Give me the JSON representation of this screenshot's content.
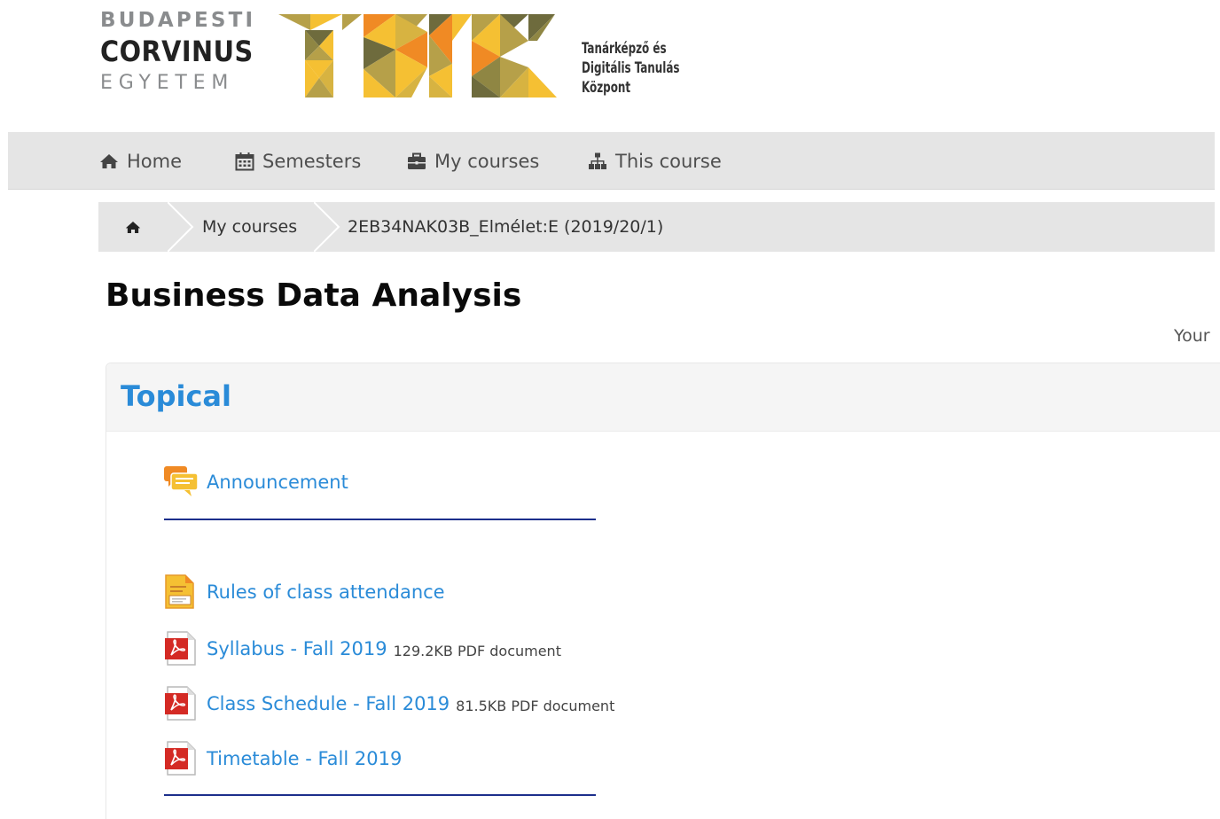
{
  "header": {
    "university_logo": {
      "line1": "BUDAPESTI",
      "line2": "CORVINUS",
      "line3": "EGYETEM"
    },
    "center_logo": {
      "line1": "Tanárképző és",
      "line2": "Digitális Tanulás",
      "line3": "Központ"
    }
  },
  "navbar": {
    "items": [
      {
        "label": "Home",
        "icon": "home-icon"
      },
      {
        "label": "Semesters",
        "icon": "calendar-icon"
      },
      {
        "label": "My courses",
        "icon": "briefcase-icon"
      },
      {
        "label": "This course",
        "icon": "sitemap-icon"
      }
    ]
  },
  "breadcrumb": {
    "items": [
      {
        "label": "",
        "icon": "home-icon"
      },
      {
        "label": "My courses"
      },
      {
        "label": "2EB34NAK03B_Elmélet:E (2019/20/1)"
      }
    ]
  },
  "page": {
    "title": "Business Data Analysis",
    "right_link": "Your"
  },
  "section": {
    "title": "Topical",
    "activities": [
      {
        "label": "Announcement",
        "meta": "",
        "icon": "forum-icon"
      },
      {
        "label": "Rules of class attendance",
        "meta": "",
        "icon": "page-icon"
      },
      {
        "label": "Syllabus - Fall 2019",
        "meta": "129.2KB PDF document",
        "icon": "pdf-icon"
      },
      {
        "label": "Class Schedule - Fall 2019",
        "meta": "81.5KB PDF document",
        "icon": "pdf-icon"
      },
      {
        "label": "Timetable - Fall 2019",
        "meta": "",
        "icon": "pdf-icon"
      }
    ]
  },
  "colors": {
    "link": "#2a8bd8",
    "navbar_bg": "#e5e5e5",
    "divider": "#1c2f8c",
    "logo_yellow": "#f5c033",
    "logo_orange": "#f08a24",
    "logo_olive": "#b6a049",
    "logo_dark": "#6e6b3d"
  }
}
